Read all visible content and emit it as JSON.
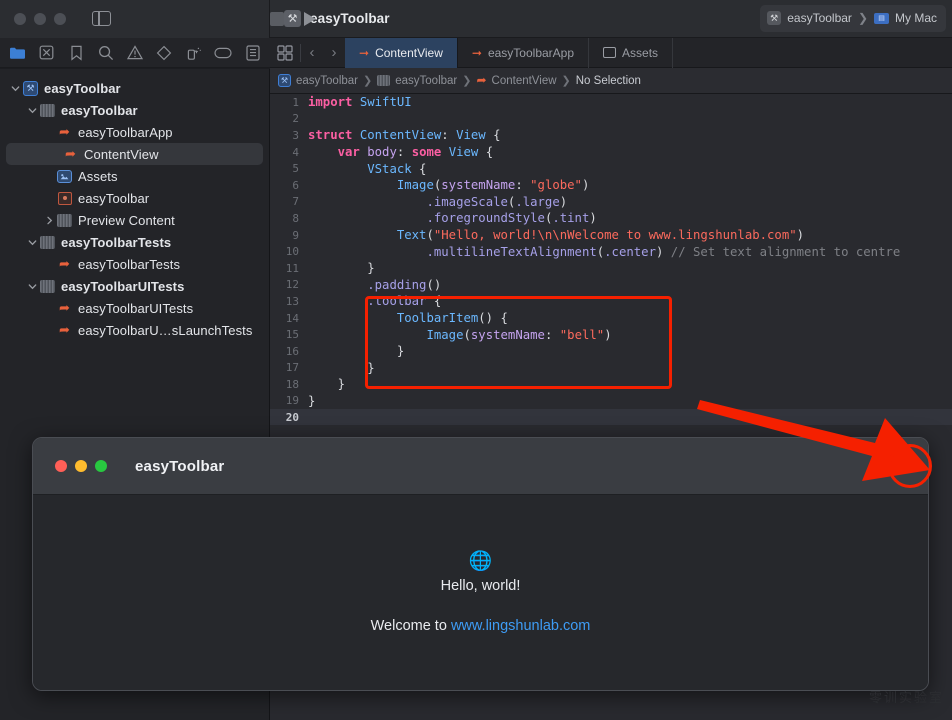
{
  "titlebar": {
    "project_icon": "xcode-project-icon",
    "project_title": "easyToolbar",
    "sidebar_toggle": "sidebar-toggle-icon",
    "stop_button": "stop-button",
    "run_button": "run-button",
    "scheme": {
      "target": "easyToolbar",
      "separator": "❯",
      "destination": "My Mac"
    }
  },
  "navigator_toolbar": {
    "icons": [
      {
        "name": "folder-icon",
        "active": true
      },
      {
        "name": "source-control-icon",
        "active": false
      },
      {
        "name": "bookmark-icon",
        "active": false
      },
      {
        "name": "search-icon",
        "active": false
      },
      {
        "name": "issue-warning-icon",
        "active": false
      },
      {
        "name": "test-diamond-icon",
        "active": false
      },
      {
        "name": "debug-spray-icon",
        "active": false
      },
      {
        "name": "breakpoint-tag-icon",
        "active": false
      },
      {
        "name": "report-list-icon",
        "active": false
      }
    ]
  },
  "sidebar": {
    "items": [
      {
        "label": "easyToolbar",
        "indent": 0,
        "icon": "project",
        "disclosure": "down",
        "bold": true,
        "selected": false
      },
      {
        "label": "easyToolbar",
        "indent": 1,
        "icon": "folder",
        "disclosure": "down",
        "bold": true,
        "selected": false
      },
      {
        "label": "easyToolbarApp",
        "indent": 2,
        "icon": "swift",
        "disclosure": "none",
        "bold": false,
        "selected": false
      },
      {
        "label": "ContentView",
        "indent": 2,
        "icon": "swift",
        "disclosure": "none",
        "bold": false,
        "selected": true
      },
      {
        "label": "Assets",
        "indent": 2,
        "icon": "assets",
        "disclosure": "none",
        "bold": false,
        "selected": false
      },
      {
        "label": "easyToolbar",
        "indent": 2,
        "icon": "entitle",
        "disclosure": "none",
        "bold": false,
        "selected": false
      },
      {
        "label": "Preview Content",
        "indent": 2,
        "icon": "folder",
        "disclosure": "right",
        "bold": false,
        "selected": false
      },
      {
        "label": "easyToolbarTests",
        "indent": 1,
        "icon": "folder",
        "disclosure": "down",
        "bold": true,
        "selected": false
      },
      {
        "label": "easyToolbarTests",
        "indent": 2,
        "icon": "swift",
        "disclosure": "none",
        "bold": false,
        "selected": false
      },
      {
        "label": "easyToolbarUITests",
        "indent": 1,
        "icon": "folder",
        "disclosure": "down",
        "bold": true,
        "selected": false
      },
      {
        "label": "easyToolbarUITests",
        "indent": 2,
        "icon": "swift",
        "disclosure": "none",
        "bold": false,
        "selected": false
      },
      {
        "label": "easyToolbarU…sLaunchTests",
        "indent": 2,
        "icon": "swift",
        "disclosure": "none",
        "bold": false,
        "selected": false
      }
    ]
  },
  "editor": {
    "grid_icon": "editor-grid-icon",
    "back_icon": "‹",
    "forward_icon": "›",
    "tabs": [
      {
        "label": "ContentView",
        "icon": "swift-file-icon",
        "active": true
      },
      {
        "label": "easyToolbarApp",
        "icon": "swift-file-icon",
        "active": false
      },
      {
        "label": "Assets",
        "icon": "assets-file-icon",
        "active": false
      }
    ],
    "breadcrumb": [
      "easyToolbar",
      "easyToolbar",
      "ContentView",
      "No Selection"
    ],
    "breadcrumb_separator": "❯",
    "lines": [
      {
        "n": "1",
        "active": false
      },
      {
        "n": "2",
        "active": false
      },
      {
        "n": "3",
        "active": false
      },
      {
        "n": "4",
        "active": false
      },
      {
        "n": "5",
        "active": false
      },
      {
        "n": "6",
        "active": false
      },
      {
        "n": "7",
        "active": false
      },
      {
        "n": "8",
        "active": false
      },
      {
        "n": "9",
        "active": false
      },
      {
        "n": "10",
        "active": false
      },
      {
        "n": "11",
        "active": false
      },
      {
        "n": "12",
        "active": false
      },
      {
        "n": "13",
        "active": false
      },
      {
        "n": "14",
        "active": false
      },
      {
        "n": "15",
        "active": false
      },
      {
        "n": "16",
        "active": false
      },
      {
        "n": "17",
        "active": false
      },
      {
        "n": "18",
        "active": false
      },
      {
        "n": "19",
        "active": false
      },
      {
        "n": "20",
        "active": true
      }
    ],
    "code_text": [
      "import SwiftUI",
      "",
      "struct ContentView: View {",
      "    var body: some View {",
      "        VStack {",
      "            Image(systemName: \"globe\")",
      "                .imageScale(.large)",
      "                .foregroundStyle(.tint)",
      "            Text(\"Hello, world!\\n\\nWelcome to www.lingshunlab.com\")",
      "                .multilineTextAlignment(.center) // Set text alignment to centre",
      "        }",
      "        .padding()",
      "        .toolbar {",
      "            ToolbarItem() {",
      "                Image(systemName: \"bell\")",
      "            }",
      "        }",
      "    }",
      "}",
      ""
    ]
  },
  "annotations": {
    "highlight_rect_color": "#f52000",
    "arrow_color": "#f52000",
    "bell_ring_color": "#f52000"
  },
  "preview": {
    "window_title": "easyToolbar",
    "traffic_lights": [
      "close-red",
      "minimize-yellow",
      "zoom-green"
    ],
    "toolbar_bell_icon": "bell-icon",
    "globe_icon": "globe-icon",
    "hello_text": "Hello, world!",
    "welcome_prefix": "Welcome to ",
    "welcome_link": "www.lingshunlab.com"
  },
  "watermark": "零训实验室"
}
